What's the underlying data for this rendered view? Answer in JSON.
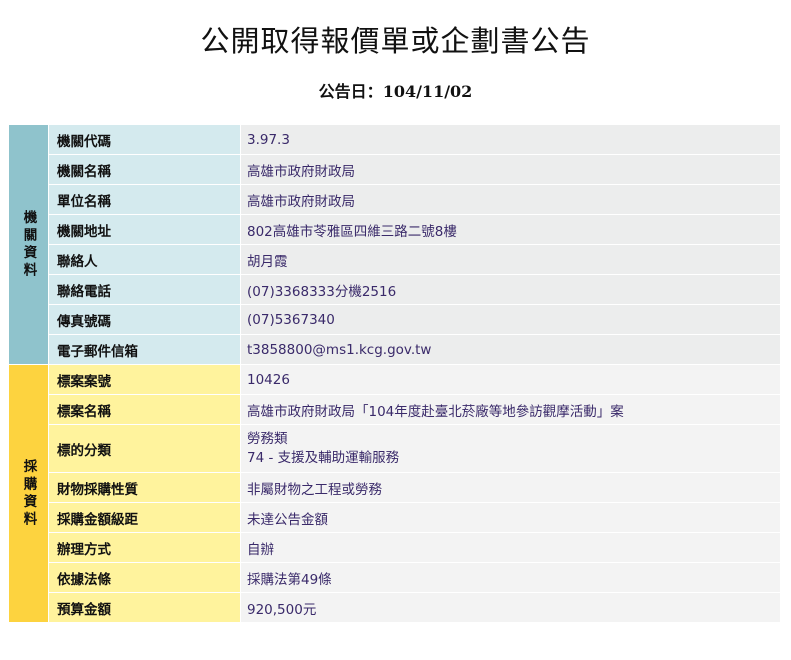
{
  "header": {
    "title": "公開取得報價單或企劃書公告",
    "date_label": "公告日：",
    "date_value": "104/11/02"
  },
  "agency": {
    "section_label": "機關資料",
    "rows": [
      {
        "label": "機關代碼",
        "value": "3.97.3"
      },
      {
        "label": "機關名稱",
        "value": "高雄市政府財政局"
      },
      {
        "label": "單位名稱",
        "value": "高雄市政府財政局"
      },
      {
        "label": "機關地址",
        "value": "802高雄市苓雅區四維三路二號8樓"
      },
      {
        "label": "聯絡人",
        "value": "胡月霞"
      },
      {
        "label": "聯絡電話",
        "value": "(07)3368333分機2516"
      },
      {
        "label": "傳真號碼",
        "value": "(07)5367340"
      },
      {
        "label": "電子郵件信箱",
        "value": "t3858800@ms1.kcg.gov.tw"
      }
    ]
  },
  "procurement": {
    "section_label": "採購資料",
    "rows": [
      {
        "label": "標案案號",
        "value": "10426"
      },
      {
        "label": "標案名稱",
        "value": "高雄市政府財政局「104年度赴臺北菸廠等地參訪觀摩活動」案"
      },
      {
        "label": "標的分類",
        "value_line1": "勞務類",
        "value_line2": "74 - 支援及輔助運輸服務"
      },
      {
        "label": "財物採購性質",
        "value": "非屬財物之工程或勞務"
      },
      {
        "label": "採購金額級距",
        "value": "未達公告金額"
      },
      {
        "label": "辦理方式",
        "value": "自辦"
      },
      {
        "label": "依據法條",
        "value": "採購法第49條"
      },
      {
        "label": "預算金額",
        "value": "920,500元"
      }
    ]
  },
  "colors": {
    "agency_section": "#8fc3cc",
    "agency_label": "#d4eaee",
    "procurement_section": "#fdd33f",
    "procurement_label": "#fff39d",
    "value_text": "#3a2a6a"
  }
}
